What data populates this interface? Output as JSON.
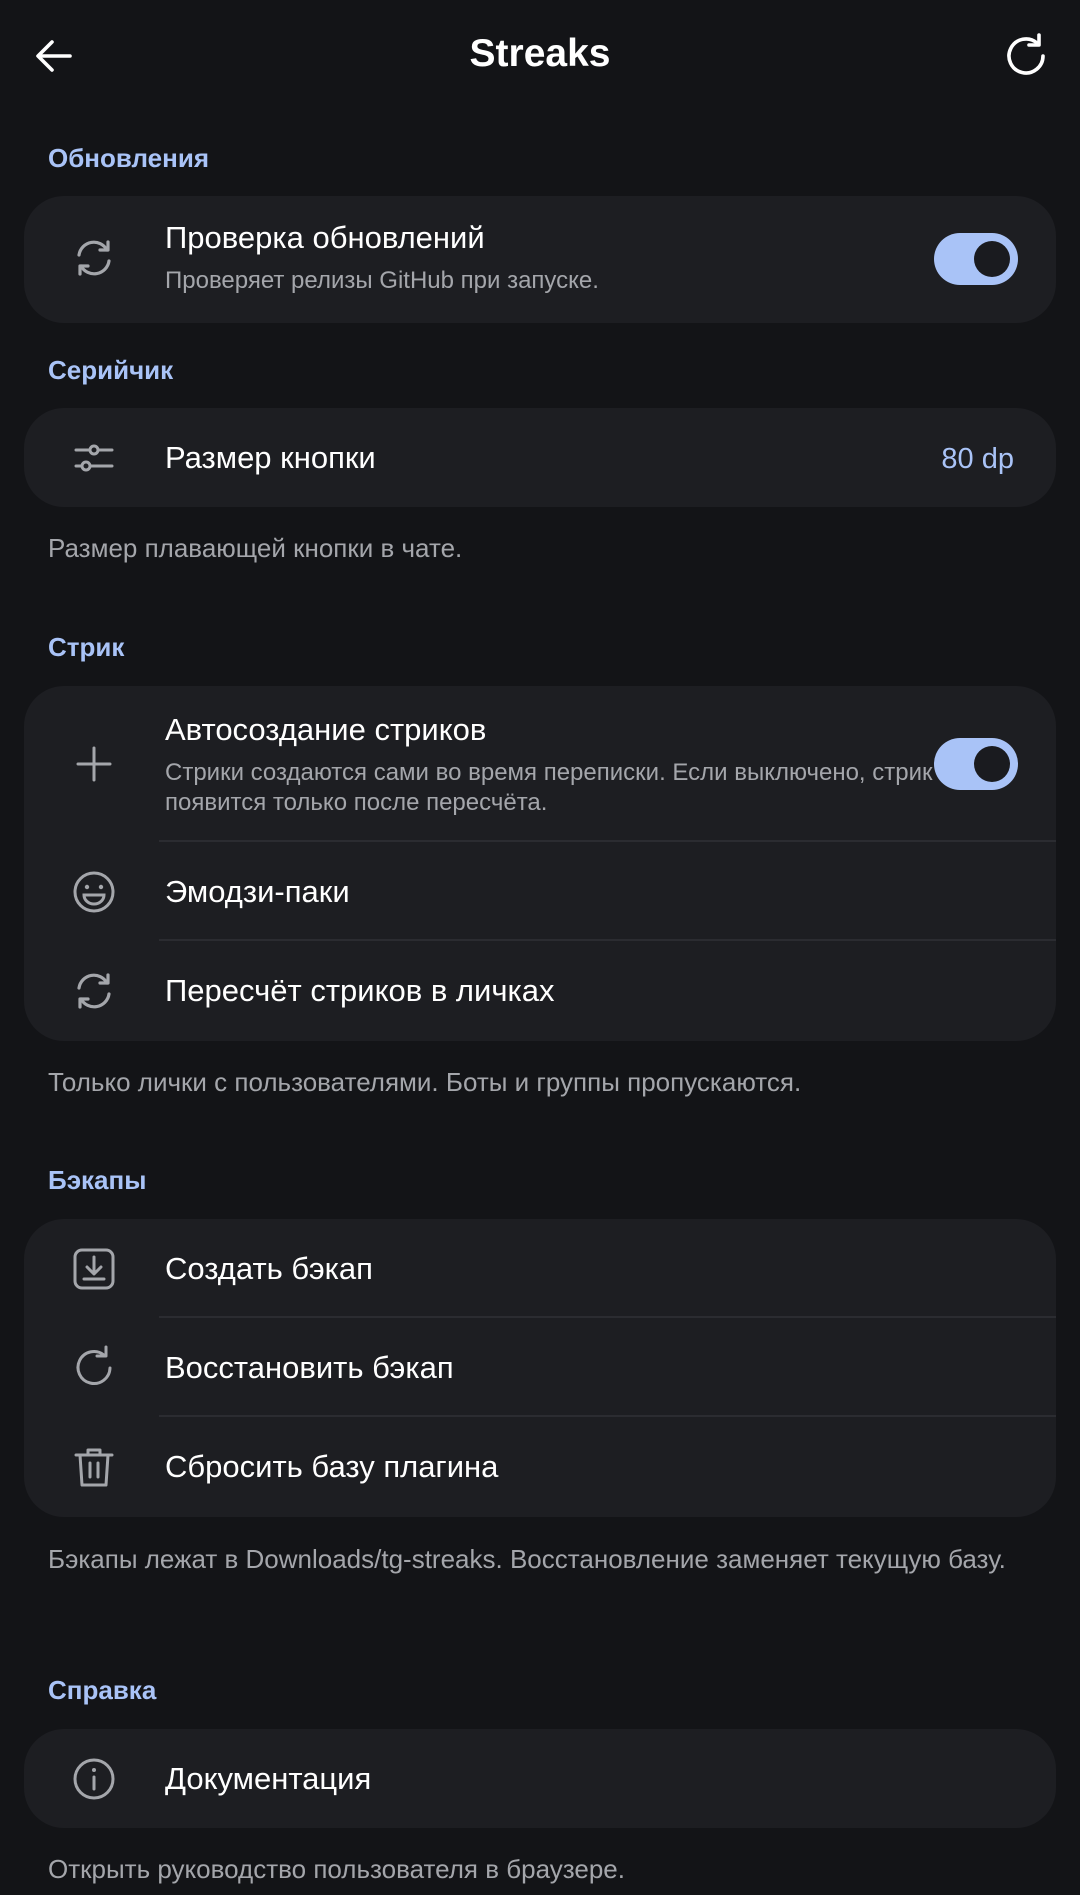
{
  "app_bar": {
    "title": "Streaks",
    "back_icon": "arrow-left-icon",
    "refresh_icon": "refresh-icon"
  },
  "colors": {
    "background": "#131417",
    "card": "#1d1e22",
    "accent": "#a9c3f7",
    "secondary_text": "#a4a6ab"
  },
  "sections": {
    "updates": {
      "header": "Обновления",
      "items": [
        {
          "title": "Проверка обновлений",
          "subtitle": "Проверяет релизы GitHub при запуске.",
          "icon": "sync-icon",
          "toggle_on": true
        }
      ]
    },
    "serial": {
      "header": "Серийчик",
      "items": [
        {
          "title": "Размер кнопки",
          "value": "80 dp",
          "icon": "sliders-icon"
        }
      ],
      "footnote": "Размер плавающей кнопки в чате."
    },
    "streak": {
      "header": "Стрик",
      "items": [
        {
          "title": "Автосоздание стриков",
          "subtitle": "Стрики создаются сами во время переписки. Если выключено, стрик появится только после пересчёта.",
          "icon": "plus-icon",
          "toggle_on": true
        },
        {
          "title": "Эмодзи-паки",
          "icon": "smiley-icon"
        },
        {
          "title": "Пересчёт стриков в личках",
          "icon": "sync-icon"
        }
      ],
      "footnote": "Только лички с пользователями. Боты и группы пропускаются."
    },
    "backups": {
      "header": "Бэкапы",
      "items": [
        {
          "title": "Создать бэкап",
          "icon": "download-icon"
        },
        {
          "title": "Восстановить бэкап",
          "icon": "restore-icon"
        },
        {
          "title": "Сбросить базу плагина",
          "icon": "trash-icon"
        }
      ],
      "footnote": "Бэкапы лежат в Downloads/tg-streaks. Восстановление заменяет текущую базу."
    },
    "help": {
      "header": "Справка",
      "items": [
        {
          "title": "Документация",
          "icon": "info-icon"
        }
      ],
      "footnote": "Открыть руководство пользователя в браузере."
    }
  }
}
